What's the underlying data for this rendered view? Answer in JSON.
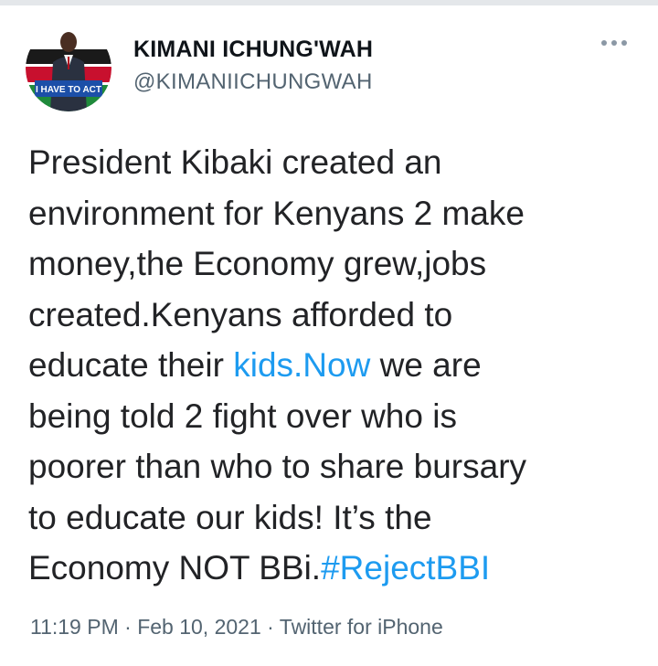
{
  "author": {
    "display_name": "KIMANI ICHUNG'WAH",
    "handle": "@KIMANIICHUNGWAH",
    "avatar_banner_text": "I HAVE TO ACT"
  },
  "menu": {
    "more_icon": "more-horizontal-icon"
  },
  "tweet": {
    "line1": "President Kibaki created an",
    "line2": "environment for Kenyans 2 make",
    "line3": "money,the Economy grew,jobs",
    "line4": "created.Kenyans afforded to",
    "line5_pre": "educate their ",
    "line5_link": "kids.Now",
    "line5_post": " we are",
    "line6": "being told 2 fight over who is",
    "line7": "poorer than who to share bursary",
    "line8": "to educate our kids! It’s the",
    "line9_pre": "Economy NOT BBi.",
    "line9_hashtag": "#RejectBBI"
  },
  "meta": {
    "time": "11:19 PM",
    "sep1": " · ",
    "date": "Feb 10, 2021",
    "sep2": " · ",
    "source": "Twitter for iPhone"
  },
  "colors": {
    "link": "#1d9bf0",
    "text": "#222326",
    "muted": "#536471"
  }
}
